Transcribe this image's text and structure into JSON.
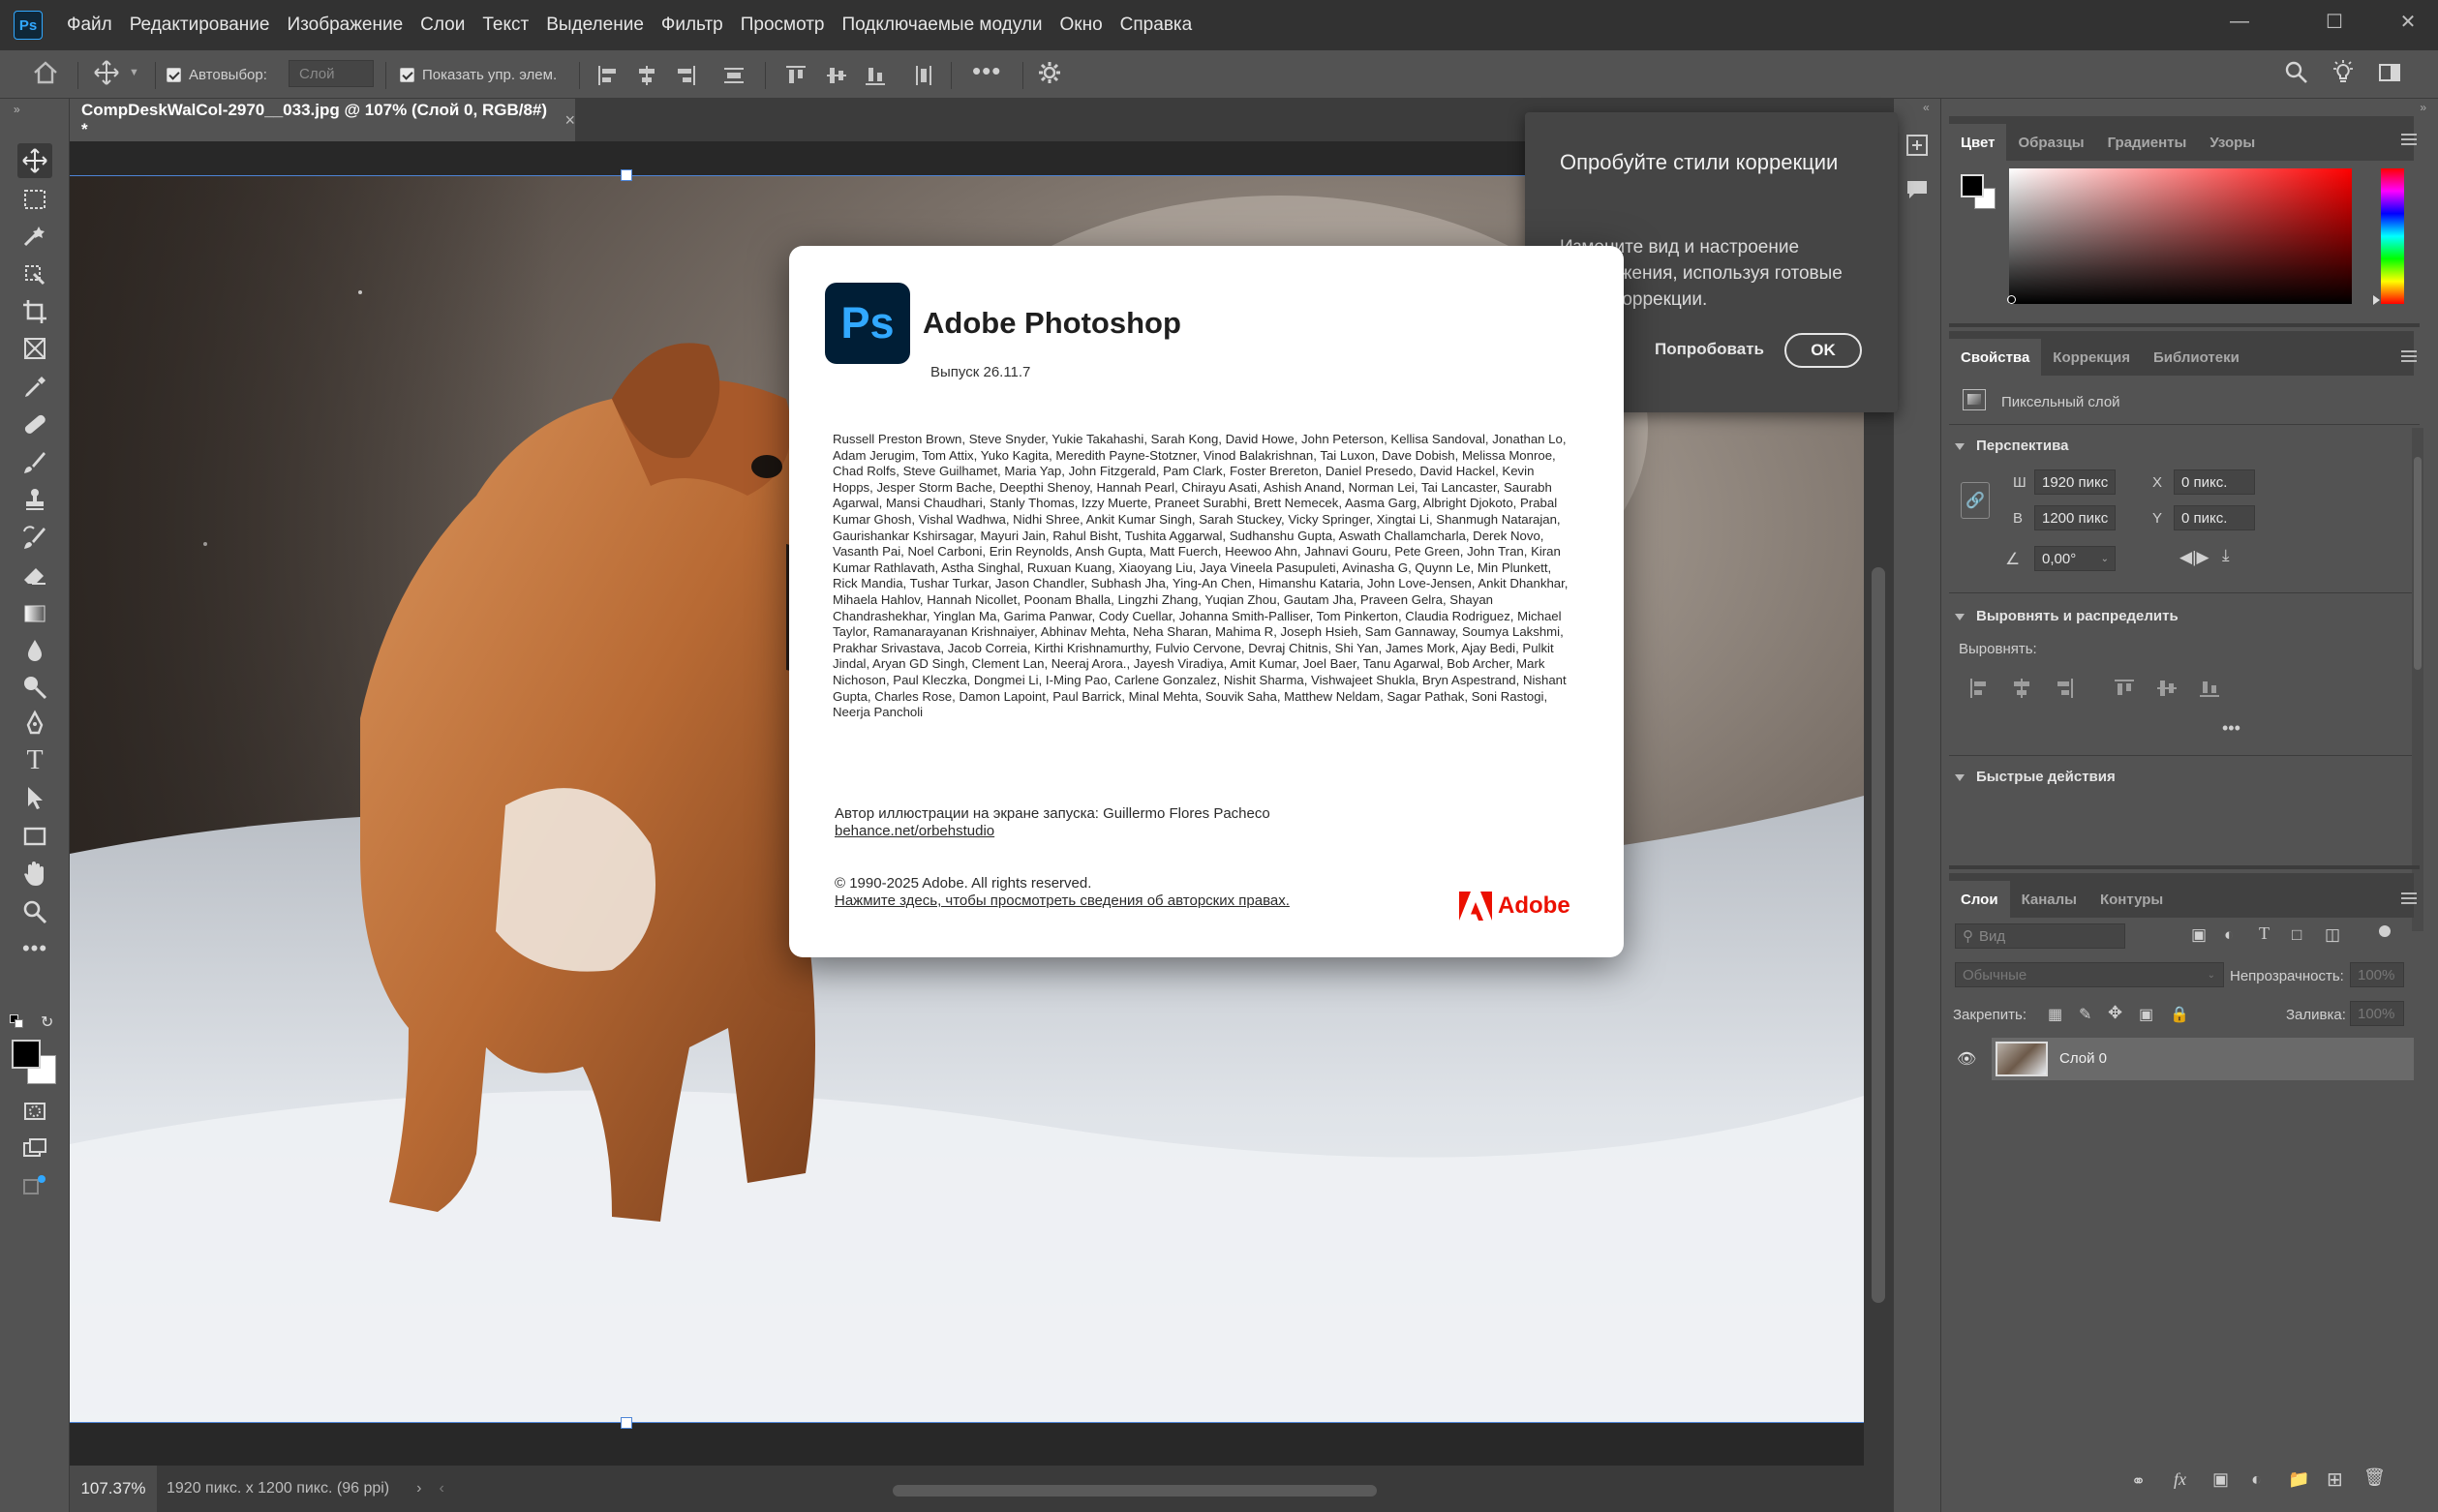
{
  "app": {
    "logo": "Ps"
  },
  "menu": [
    "Файл",
    "Редактирование",
    "Изображение",
    "Слои",
    "Текст",
    "Выделение",
    "Фильтр",
    "Просмотр",
    "Подключаемые модули",
    "Окно",
    "Справка"
  ],
  "options": {
    "autoselect_label": "Автовыбор:",
    "layer_select": "Слой",
    "show_transform_label": "Показать упр. элем."
  },
  "document": {
    "tab_title": "CompDeskWalCol-2970__033.jpg @ 107% (Слой 0, RGB/8#) *",
    "zoom": "107.37%",
    "info": "1920 пикс. x 1200 пикс. (96 ppi)"
  },
  "tip": {
    "title": "Опробуйте стили коррекции",
    "body": "Измените вид и настроение изображения, используя готовые стили коррекции.",
    "try_label": "Попробовать",
    "ok_label": "OK"
  },
  "about": {
    "logo": "Ps",
    "title": "Adobe Photoshop",
    "version": "Выпуск 26.11.7",
    "credits": "Russell Preston Brown, Steve Snyder, Yukie Takahashi, Sarah Kong, David Howe, John Peterson, Kellisa Sandoval, Jonathan Lo, Adam Jerugim, Tom Attix, Yuko Kagita, Meredith Payne-Stotzner, Vinod Balakrishnan, Tai Luxon, Dave Dobish, Melissa Monroe, Chad Rolfs, Steve Guilhamet, Maria Yap, John Fitzgerald, Pam Clark, Foster Brereton, Daniel Presedo, David Hackel, Kevin Hopps, Jesper Storm Bache, Deepthi Shenoy, Hannah Pearl, Chirayu Asati, Ashish Anand, Norman Lei, Tai Lancaster, Saurabh Agarwal, Mansi Chaudhari, Stanly Thomas, Izzy Muerte, Praneet Surabhi, Brett Nemecek, Aasma Garg, Albright Djokoto, Prabal Kumar Ghosh, Vishal Wadhwa, Nidhi Shree, Ankit Kumar Singh, Sarah Stuckey, Vicky Springer, Xingtai Li, Shanmugh Natarajan, Gaurishankar Kshirsagar, Mayuri Jain, Rahul Bisht, Tushita Aggarwal, Sudhanshu Gupta, Aswath Challamcharla, Derek Novo, Vasanth Pai, Noel Carboni, Erin Reynolds, Ansh Gupta, Matt Fuerch, Heewoo Ahn, Jahnavi Gouru, Pete Green, John Tran, Kiran Kumar Rathlavath, Astha Singhal, Ruxuan Kuang, Xiaoyang Liu, Jaya Vineela Pasupuleti, Avinasha G, Quynn Le, Min Plunkett, Rick Mandia, Tushar Turkar, Jason Chandler, Subhash Jha, Ying-An Chen, Himanshu Kataria, John Love-Jensen, Ankit Dhankhar, Mihaela Hahlov, Hannah Nicollet, Poonam Bhalla, Lingzhi Zhang, Yuqian Zhou, Gautam Jha, Praveen Gelra, Shayan Chandrashekhar, Yinglan Ma, Garima Panwar, Cody Cuellar, Johanna Smith-Palliser, Tom Pinkerton, Claudia Rodriguez, Michael Taylor, Ramanarayanan Krishnaiyer, Abhinav Mehta, Neha Sharan, Mahima R, Joseph Hsieh, Sam Gannaway, Soumya Lakshmi, Prakhar Srivastava, Jacob Correia, Kirthi Krishnamurthy, Fulvio Cervone, Devraj Chitnis, Shi Yan, James Mork, Ajay Bedi, Pulkit Jindal, Aryan GD Singh, Clement Lan, Neeraj Arora., Jayesh Viradiya, Amit Kumar, Joel Baer, Tanu Agarwal, Bob Archer, Mark Nichoson, Paul Kleczka, Dongmei Li, I-Ming Pao, Carlene Gonzalez, Nishit Sharma, Vishwajeet Shukla, Bryn Aspestrand, Nishant Gupta, Charles Rose, Damon Lapoint, Paul Barrick, Minal Mehta, Souvik Saha, Matthew Neldam, Sagar Pathak, Soni Rastogi, Neerja Pancholi",
    "artist_label": "Автор иллюстрации на экране запуска: Guillermo Flores Pacheco",
    "artist_link": "behance.net/orbehstudio",
    "copyright": "© 1990-2025 Adobe. All rights reserved.",
    "legal_link": "Нажмите здесь, чтобы просмотреть сведения об авторских правах.",
    "brand": "Adobe"
  },
  "panels": {
    "color_tabs": [
      "Цвет",
      "Образцы",
      "Градиенты",
      "Узоры"
    ],
    "props_tabs": [
      "Свойства",
      "Коррекция",
      "Библиотеки"
    ],
    "layer_kind": "Пиксельный слой",
    "perspective": "Перспектива",
    "w_label": "Ш",
    "w_value": "1920 пикс",
    "h_label": "В",
    "h_value": "1200 пикс",
    "x_label": "X",
    "x_value": "0 пикс.",
    "y_label": "Y",
    "y_value": "0 пикс.",
    "angle_value": "0,00°",
    "align_section": "Выровнять и распределить",
    "align_label": "Выровнять:",
    "quick_actions": "Быстрые действия",
    "layers_tabs": [
      "Слои",
      "Каналы",
      "Контуры"
    ],
    "kind_filter": "Вид",
    "blend_mode": "Обычные",
    "opacity_label": "Непрозрачность:",
    "opacity_value": "100%",
    "lock_label": "Закрепить:",
    "fill_label": "Заливка:",
    "fill_value": "100%",
    "layer_name": "Слой 0"
  },
  "colors": {
    "accent": "#31a8ff",
    "fg": "#000000",
    "bg": "#ffffff",
    "adobe_red": "#eb1000"
  }
}
